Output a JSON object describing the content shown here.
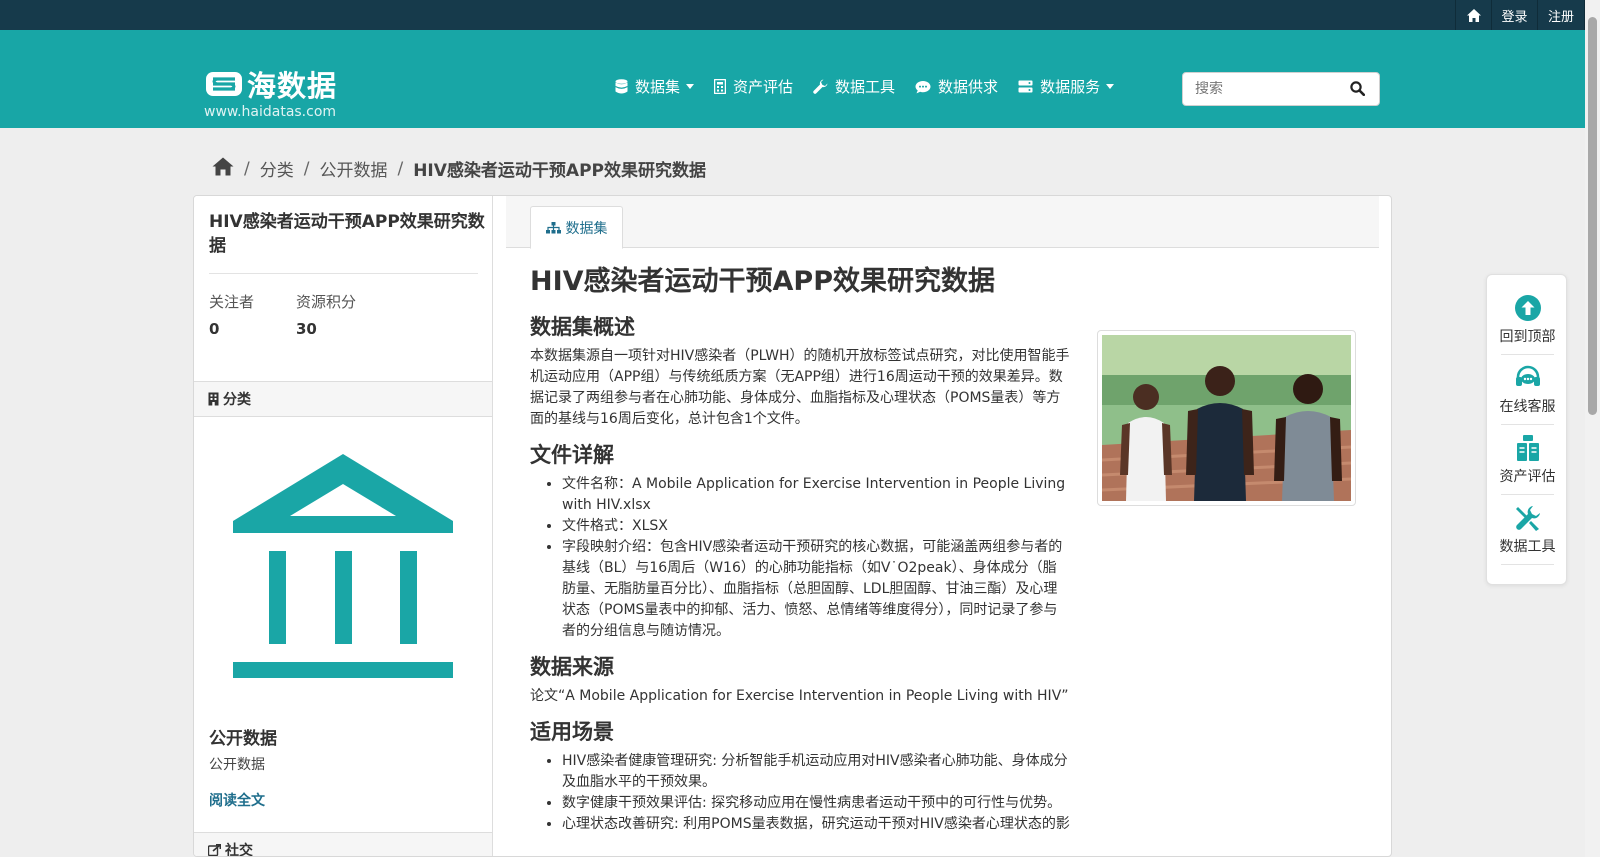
{
  "topbar": {
    "home_icon": "home-icon",
    "login": "登录",
    "register": "注册"
  },
  "brand": {
    "name": "海数据",
    "url": "www.haidatas.com"
  },
  "nav": {
    "items": [
      {
        "label": "数据集",
        "icon": "database-icon"
      },
      {
        "label": "资产评估",
        "icon": "calculator-icon"
      },
      {
        "label": "数据工具",
        "icon": "wrench-icon"
      },
      {
        "label": "数据供求",
        "icon": "chat-icon"
      },
      {
        "label": "数据服务",
        "icon": "server-icon"
      }
    ]
  },
  "search": {
    "placeholder": "搜索"
  },
  "breadcrumb": {
    "home_icon": "home-icon",
    "items": [
      "分类",
      "公开数据",
      "HIV感染者运动干预APP效果研究数据"
    ]
  },
  "sidebar": {
    "title": "HIV感染者运动干预APP效果研究数据",
    "stats": [
      {
        "label": "关注者",
        "value": "0"
      },
      {
        "label": "资源积分",
        "value": "30"
      }
    ],
    "category_heading": "分类",
    "org_name": "公开数据",
    "org_desc": "公开数据",
    "read_more": "阅读全文",
    "social_heading": "社交"
  },
  "tabs": [
    {
      "label": "数据集",
      "active": true
    }
  ],
  "content": {
    "title": "HIV感染者运动干预APP效果研究数据",
    "overview_heading": "数据集概述",
    "overview": "本数据集源自一项针对HIV感染者（PLWH）的随机开放标签试点研究，对比使用智能手机运动应用（APP组）与传统纸质方案（无APP组）进行16周运动干预的效果差异。数据记录了两组参与者在心肺功能、身体成分、血脂指标及心理状态（POMS量表）等方面的基线与16周后变化，总计包含1个文件。",
    "files_heading": "文件详解",
    "files": [
      "文件名称：A Mobile Application for Exercise Intervention in People Living with HIV.xlsx",
      "文件格式：XLSX",
      "字段映射介绍：包含HIV感染者运动干预研究的核心数据，可能涵盖两组参与者的基线（BL）与16周后（W16）的心肺功能指标（如V˙O2peak）、身体成分（脂肪量、无脂肪量百分比）、血脂指标（总胆固醇、LDL胆固醇、甘油三酯）及心理状态（POMS量表中的抑郁、活力、愤怒、总情绪等维度得分），同时记录了参与者的分组信息与随访情况。"
    ],
    "source_heading": "数据来源",
    "source": "论文“A Mobile Application for Exercise Intervention in People Living with HIV”",
    "scenarios_heading": "适用场景",
    "scenarios": [
      "HIV感染者健康管理研究: 分析智能手机运动应用对HIV感染者心肺功能、身体成分及血脂水平的干预效果。",
      "数字健康干预效果评估: 探究移动应用在慢性病患者运动干预中的可行性与优势。",
      "心理状态改善研究: 利用POMS量表数据，研究运动干预对HIV感染者心理状态的影"
    ]
  },
  "float_bar": {
    "items": [
      {
        "label": "回到顶部",
        "icon": "arrow-up-circle-icon"
      },
      {
        "label": "在线客服",
        "icon": "headset-icon"
      },
      {
        "label": "资产评估",
        "icon": "assessment-icon"
      },
      {
        "label": "数据工具",
        "icon": "tools-icon"
      }
    ]
  },
  "colors": {
    "topbar": "#163a4b",
    "masthead": "#18a6a6",
    "accent": "#1aa6a6",
    "link": "#1f6e8c"
  }
}
